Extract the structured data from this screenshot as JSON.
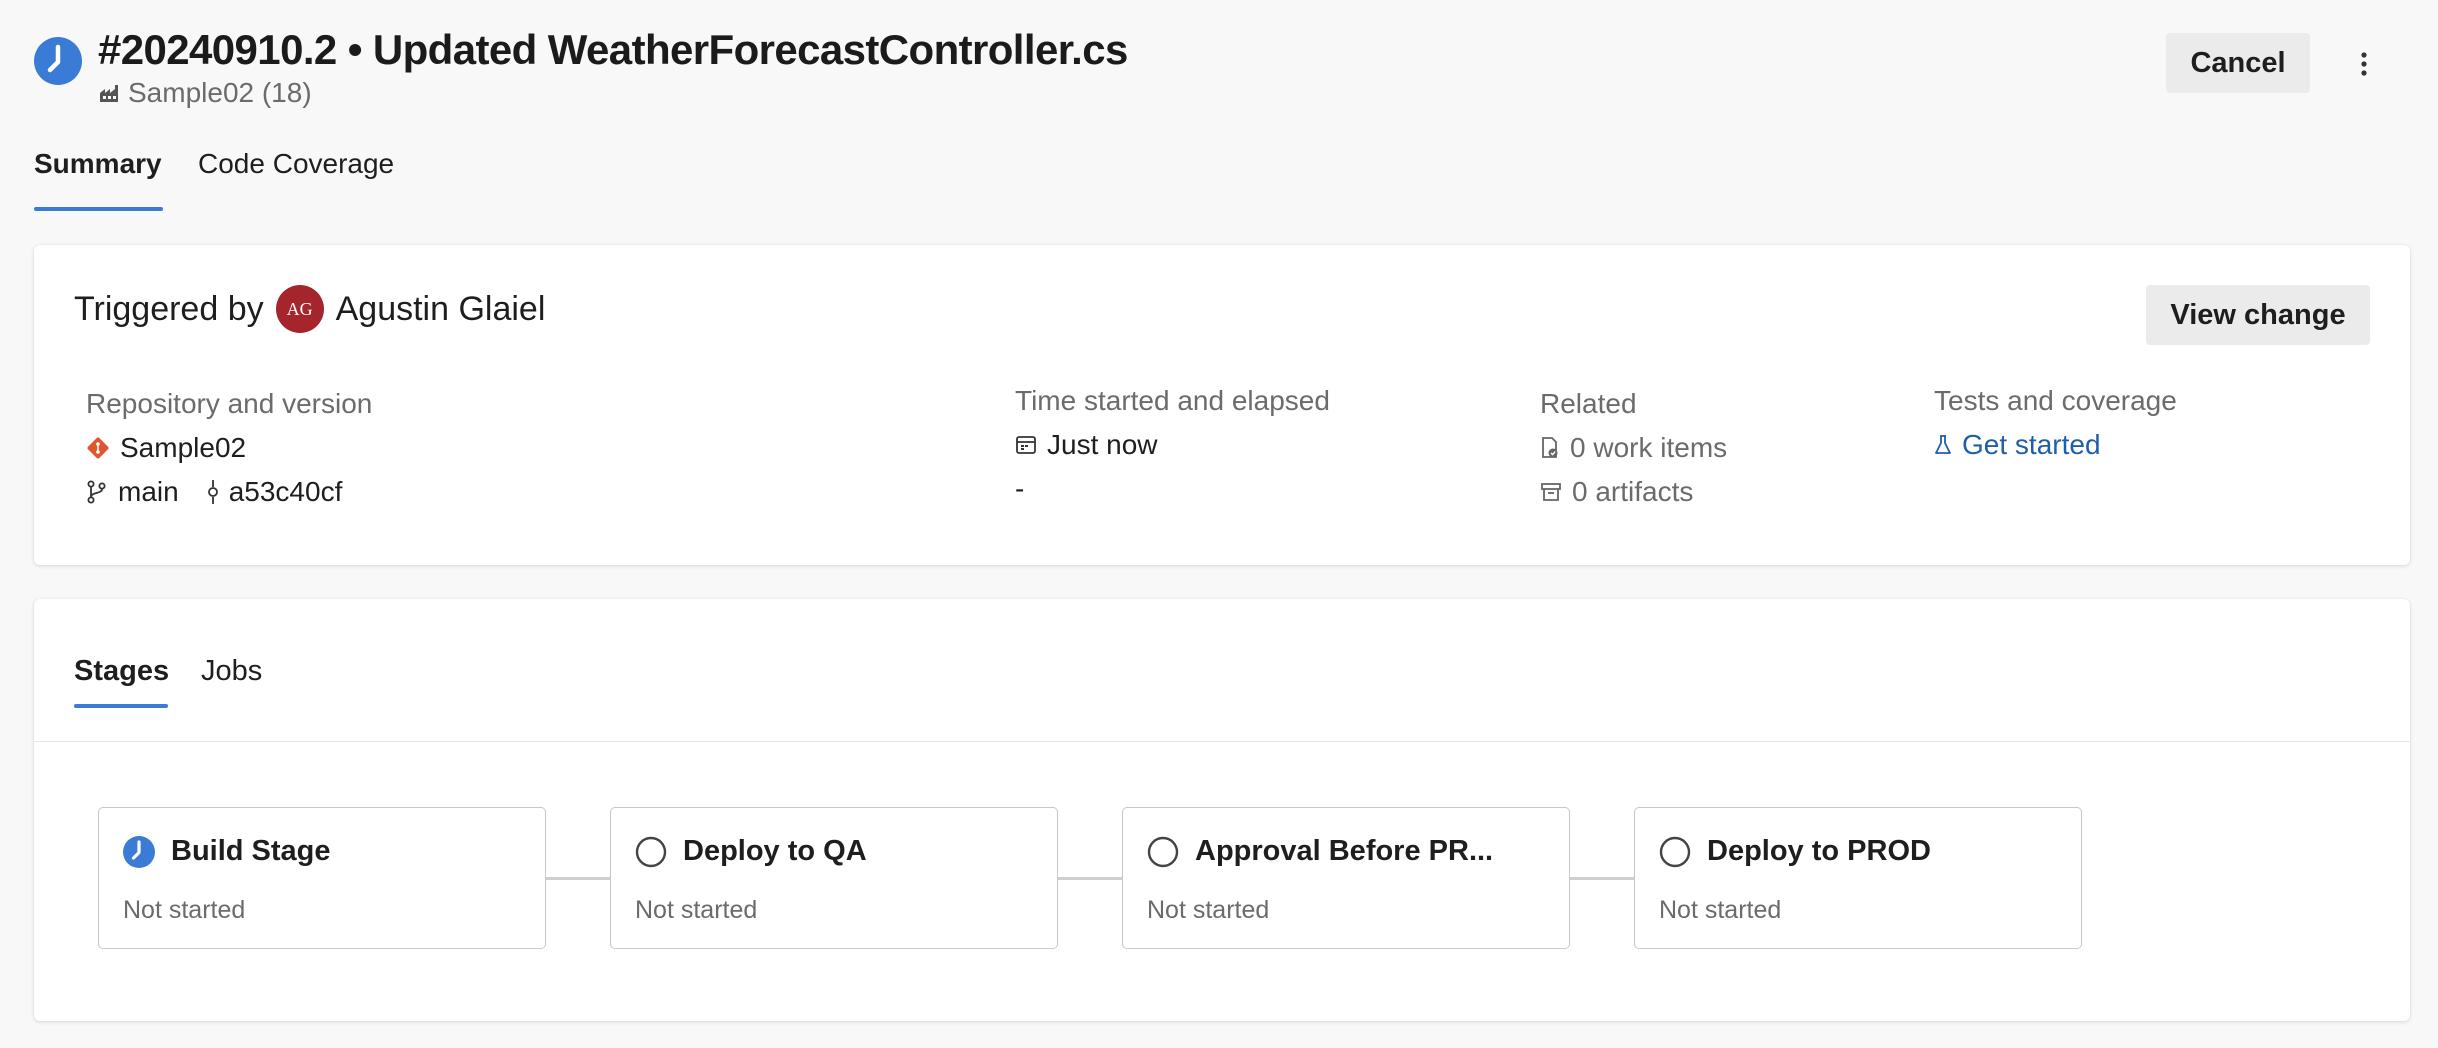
{
  "header": {
    "title": "#20240910.2 • Updated WeatherForecastController.cs",
    "pipeline": "Sample02 (18)",
    "status_icon": "clock-icon",
    "cancel_label": "Cancel",
    "more_icon": "more-vertical-icon"
  },
  "tabs": [
    {
      "label": "Summary",
      "selected": true
    },
    {
      "label": "Code Coverage",
      "selected": false
    }
  ],
  "summary": {
    "triggered_prefix": "Triggered by",
    "user_initials": "AG",
    "user_name": "Agustin Glaiel",
    "view_change_label": "View change",
    "repository": {
      "heading": "Repository and version",
      "name": "Sample02",
      "branch": "main",
      "commit": "a53c40cf"
    },
    "time": {
      "heading": "Time started and elapsed",
      "started": "Just now",
      "elapsed": "-"
    },
    "related": {
      "heading": "Related",
      "work_items": "0 work items",
      "artifacts": "0 artifacts"
    },
    "tests": {
      "heading": "Tests and coverage",
      "link": "Get started"
    }
  },
  "stage_tabs": [
    {
      "label": "Stages",
      "selected": true
    },
    {
      "label": "Jobs",
      "selected": false
    }
  ],
  "stages": [
    {
      "name": "Build Stage",
      "status": "Not started",
      "icon": "clock-icon"
    },
    {
      "name": "Deploy to QA",
      "status": "Not started",
      "icon": "empty-circle-icon"
    },
    {
      "name": "Approval Before PR...",
      "status": "Not started",
      "icon": "empty-circle-icon"
    },
    {
      "name": "Deploy to PROD",
      "status": "Not started",
      "icon": "empty-circle-icon"
    }
  ],
  "colors": {
    "accent": "#3a7bd5",
    "link": "#1f5fa8",
    "avatar": "#a4262c",
    "git": "#e0542e"
  }
}
